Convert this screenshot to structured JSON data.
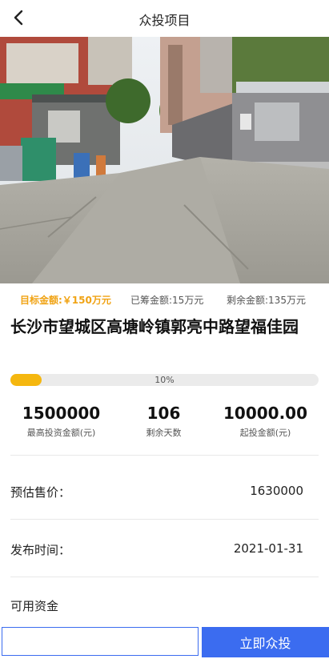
{
  "header": {
    "title": "众投项目",
    "back_icon": "chevron-left-icon"
  },
  "project": {
    "image_alt": "street-scene-photo",
    "target_amount": "目标金额:￥150万元",
    "raised_amount": "已筹金额:15万元",
    "remaining_amount": "剩余金额:135万元",
    "title": "长沙市望城区高塘岭镇郭亮中路望福佳园",
    "progress_percent": 10,
    "progress_label": "10%"
  },
  "stats": [
    {
      "value": "1500000",
      "label": "最高投资金额(元)"
    },
    {
      "value": "106",
      "label": "剩余天数"
    },
    {
      "value": "10000.00",
      "label": "起投金额(元)"
    }
  ],
  "details": {
    "estimated_price_label": "预估售价：",
    "estimated_price_value": "1630000",
    "publish_time_label": "发布时间：",
    "publish_time_value": "2021-01-31",
    "available_funds_label": "可用资金"
  },
  "footer": {
    "input_value": "",
    "invest_button_label": "立即众投"
  },
  "colors": {
    "accent_orange": "#f5b70f",
    "accent_blue": "#3b6cf0"
  }
}
